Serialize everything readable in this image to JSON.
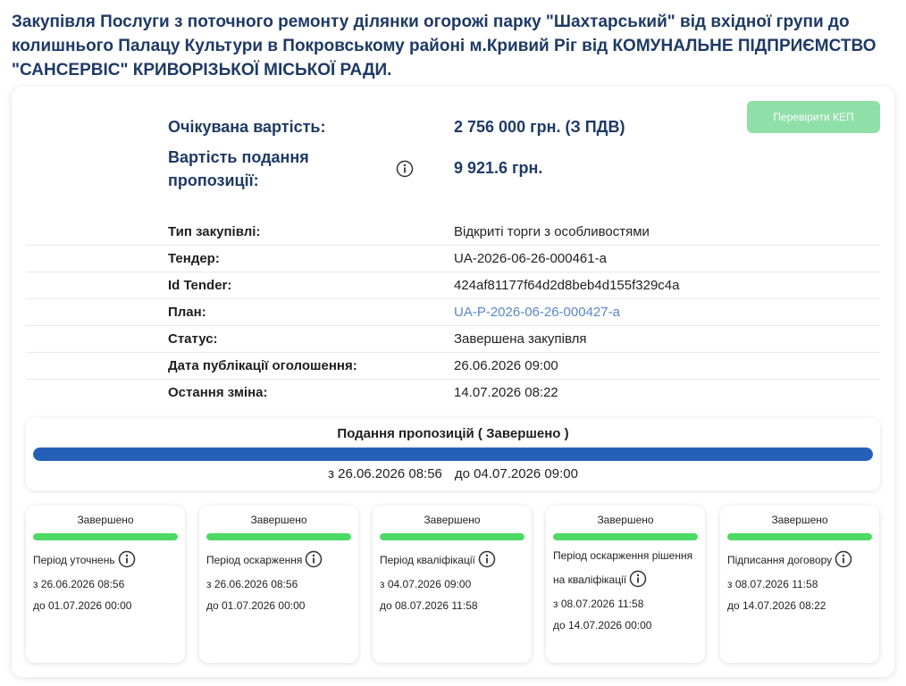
{
  "title": "Закупівля Послуги з поточного ремонту ділянки огорожі парку \"Шахтарський\" від вхідної групи до колишнього Палацу Культури в Покровському районі м.Кривий Ріг від КОМУНАЛЬНЕ ПІДПРИЄМСТВО \"САНСЕРВІС\" КРИВОРІЗЬКОЇ МІСЬКОЇ РАДИ.",
  "kep_button": "Перевірити КЕП",
  "summary": {
    "expected_label": "Очікувана вартість:",
    "expected_value": "2 756 000 грн. (З ПДВ)",
    "submission_label_line1": "Вартість подання",
    "submission_label_line2": "пропозиції:",
    "submission_value": "9 921.6 грн."
  },
  "details": [
    {
      "label": "Тип закупівлі:",
      "value": "Відкриті торги з особливостями"
    },
    {
      "label": "Тендер:",
      "value": "UA-2026-06-26-000461-a"
    },
    {
      "label": "Id Tender:",
      "value": "424af81177f64d2d8beb4d155f329c4a"
    },
    {
      "label": "План:",
      "value": "UA-P-2026-06-26-000427-a"
    },
    {
      "label": "Статус:",
      "value": "Завершена закупівля"
    },
    {
      "label": "Дата публікації оголошення:",
      "value": "26.06.2026 09:00"
    },
    {
      "label": "Остання зміна:",
      "value": "14.07.2026 08:22"
    }
  ],
  "submission_period": {
    "title": "Подання пропозицій ( Завершено )",
    "progress": 1.0,
    "from": "з 26.06.2026 08:56",
    "to": "до 04.07.2026 09:00"
  },
  "stages": [
    {
      "status": "Завершено",
      "name": "Період уточнень",
      "from": "з 26.06.2026 08:56",
      "to": "до 01.07.2026 00:00"
    },
    {
      "status": "Завершено",
      "name": "Період оскарження",
      "from": "з 26.06.2026 08:56",
      "to": "до 01.07.2026 00:00"
    },
    {
      "status": "Завершено",
      "name": "Період кваліфікації",
      "from": "з 04.07.2026 09:00",
      "to": "до 08.07.2026 11:58"
    },
    {
      "status": "Завершено",
      "name": "Період оскарження рішення на кваліфікації",
      "from": "з 08.07.2026 11:58",
      "to": "до 14.07.2026 00:00"
    },
    {
      "status": "Завершено",
      "name": "Підписання договору",
      "from": "з 08.07.2026 11:58",
      "to": "до 14.07.2026 08:22"
    }
  ],
  "colors": {
    "title": "#1e3a66",
    "link": "#5a86c8",
    "submission_bar": "#2560b8",
    "stage_bar": "#4cd964",
    "kep_button": "#8fe0a8"
  }
}
